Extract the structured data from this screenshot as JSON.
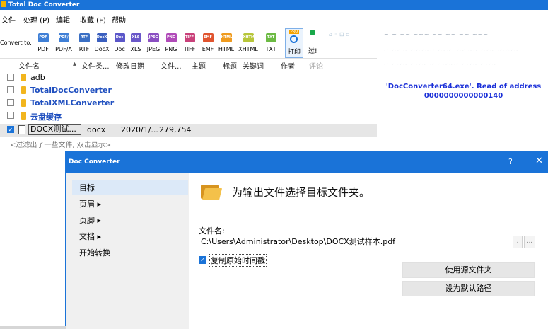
{
  "window": {
    "title": "Total Doc Converter"
  },
  "menu": [
    "文件",
    "处理 (P)",
    "编辑",
    "收藏 (F)",
    "帮助"
  ],
  "toolbar": {
    "convert_label": "Convert to:",
    "formats": [
      {
        "label": "PDF",
        "color": "#3f7fd6"
      },
      {
        "label": "PDF/A",
        "color": "#3f7fd6"
      },
      {
        "label": "RTF",
        "color": "#3a6fc4"
      },
      {
        "label": "DocX",
        "color": "#3a5fbf"
      },
      {
        "label": "Doc",
        "color": "#5b57c9"
      },
      {
        "label": "XLS",
        "color": "#6a58c9"
      },
      {
        "label": "JPEG",
        "color": "#8a4fc2"
      },
      {
        "label": "PNG",
        "color": "#b04ab8"
      },
      {
        "label": "TIFF",
        "color": "#c9417a"
      },
      {
        "label": "EMF",
        "color": "#e0542f"
      },
      {
        "label": "HTML",
        "color": "#ef9b1f"
      },
      {
        "label": "XHTML",
        "color": "#b7c63a"
      },
      {
        "label": "TXT",
        "color": "#6cba43"
      }
    ],
    "print_label": "打印",
    "print_badge": "PRO",
    "filter_label": "过!"
  },
  "columns": [
    "文件名",
    "文件类...",
    "修改日期",
    "文件...",
    "主题",
    "标题",
    "关键词",
    "作者",
    "评论"
  ],
  "files": [
    {
      "name": "adb",
      "type": "folder"
    },
    {
      "name": "TotalDocConverter",
      "type": "folder"
    },
    {
      "name": "TotalXMLConverter",
      "type": "folder"
    },
    {
      "name": "云盘缓存",
      "type": "folder"
    }
  ],
  "selected_file": {
    "name": "DOCX测试...",
    "ext": "docx",
    "date": "2020/1/...",
    "size": "279,754"
  },
  "hidden_msg": "<过滤出了一些文件, 双击显示>",
  "error_panel": {
    "line1": "'DocConverter64.exe'. Read of address",
    "line2": "0000000000000140"
  },
  "dialog": {
    "title": "Doc Converter",
    "help": "?",
    "close": "✕",
    "nav": [
      {
        "label": "目标",
        "arrow": ""
      },
      {
        "label": "页眉",
        "arrow": "▸"
      },
      {
        "label": "页脚",
        "arrow": "▸"
      },
      {
        "label": "文档",
        "arrow": "▸"
      },
      {
        "label": "开始转换",
        "arrow": ""
      }
    ],
    "heading": "为输出文件选择目标文件夹。",
    "filename_label": "文件名:",
    "path_value": "C:\\Users\\Administrator\\Desktop\\DOCX测试样本.pdf",
    "btn_dot": ".",
    "btn_more": "...",
    "keep_time_label": "复制原始时间戳",
    "use_source_btn": "使用源文件夹",
    "set_default_btn": "设为默认路径"
  }
}
